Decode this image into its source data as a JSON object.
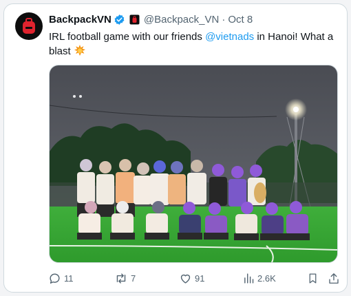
{
  "post": {
    "display_name": "BackpackVN",
    "handle": "@Backpack_VN",
    "separator": "·",
    "date": "Oct 8",
    "text_before": "IRL football game with our friends ",
    "mention": "@vietnads",
    "text_after": " in Hanoi! What a blast "
  },
  "actions": {
    "replies": "11",
    "reposts": "7",
    "likes": "91",
    "views": "2.6K"
  },
  "colors": {
    "accent": "#1d9bf0",
    "brand": "#e0232e",
    "text": "#0f1419",
    "muted": "#536471"
  },
  "icons": [
    "backpack-logo-icon",
    "verified-badge-icon",
    "affiliate-badge-icon",
    "collision-emoji-icon",
    "reply-icon",
    "repost-icon",
    "like-icon",
    "views-icon",
    "bookmark-icon",
    "share-icon"
  ]
}
